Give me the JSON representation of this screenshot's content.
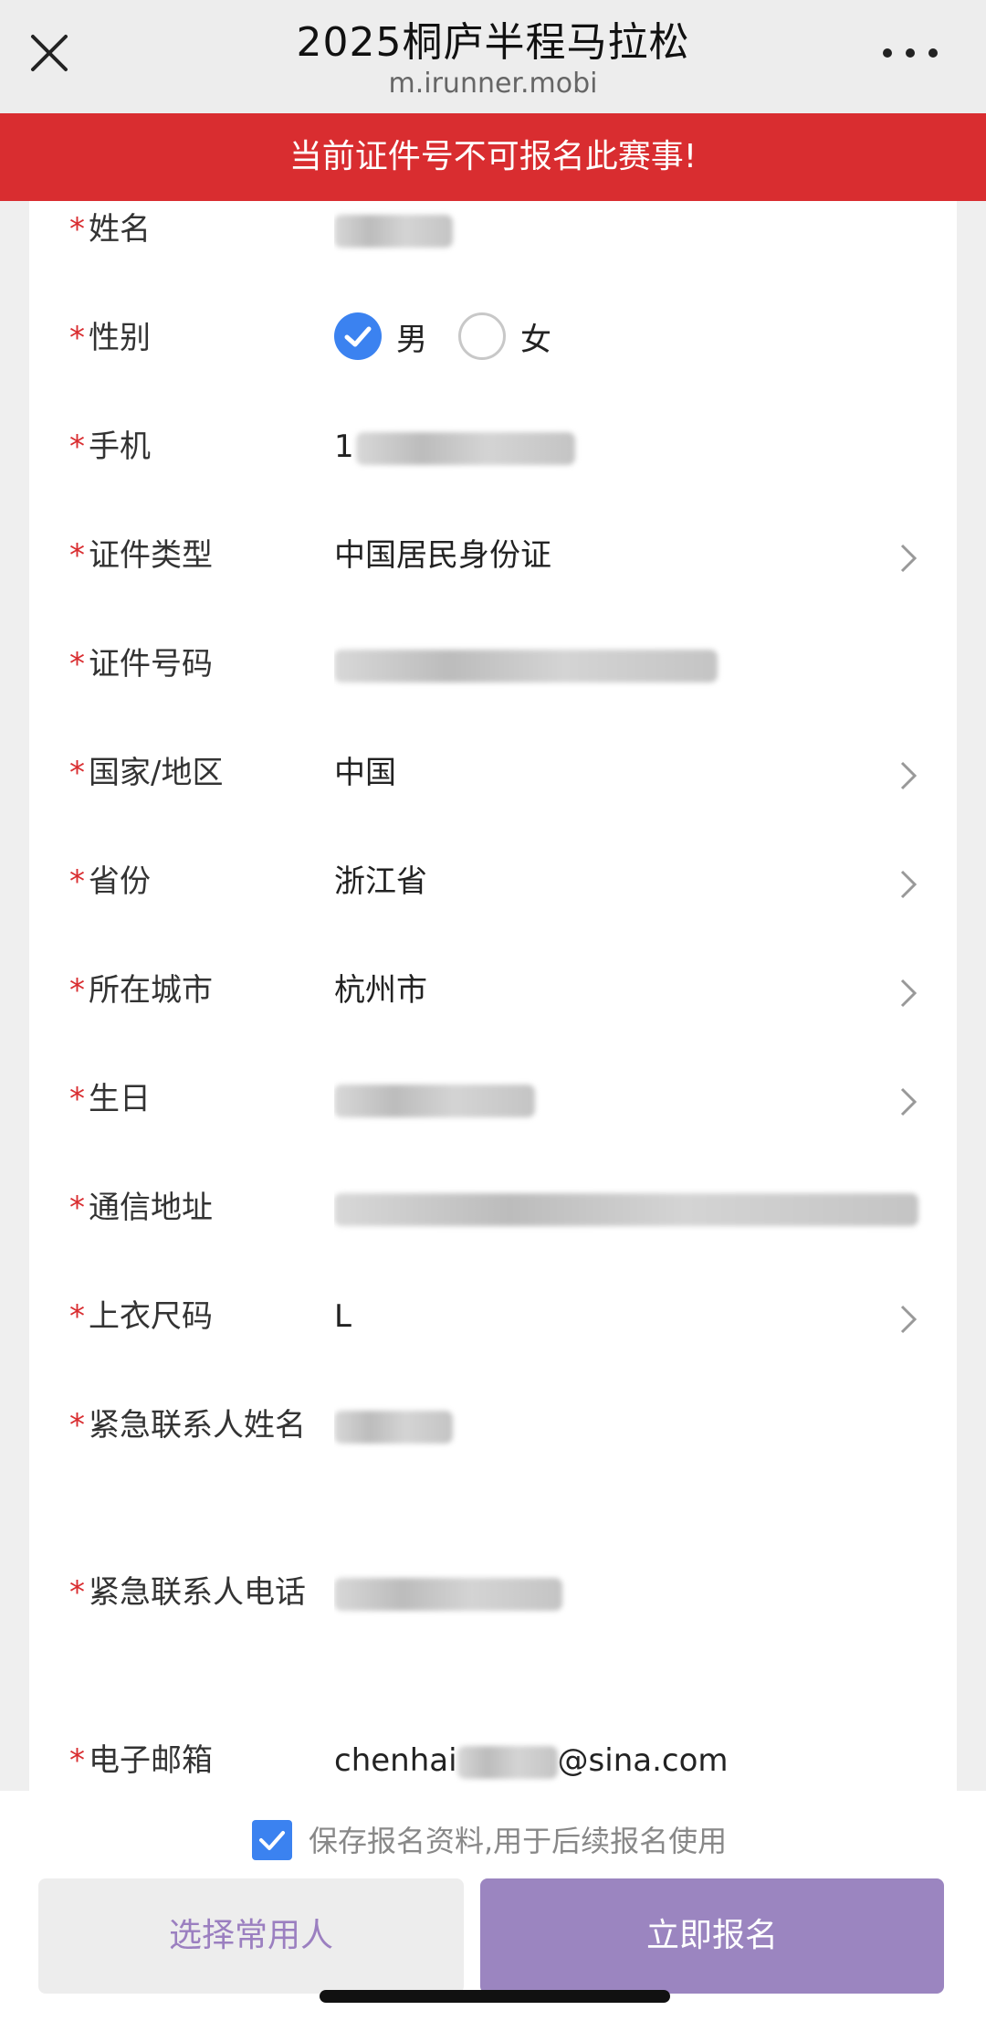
{
  "topbar": {
    "title": "2025桐庐半程马拉松",
    "subtitle": "m.irunner.mobi",
    "close_icon": "close-icon",
    "more_icon": "more-horizontal-icon"
  },
  "alert": {
    "text": "当前证件号不可报名此赛事!"
  },
  "form": {
    "required_mark": "*",
    "name": {
      "label": "姓名"
    },
    "gender": {
      "label": "性别",
      "options": [
        "男",
        "女"
      ],
      "selected": "男"
    },
    "phone": {
      "label": "手机",
      "value_visible": "1"
    },
    "id_type": {
      "label": "证件类型",
      "value": "中国居民身份证"
    },
    "id_number": {
      "label": "证件号码"
    },
    "country": {
      "label": "国家/地区",
      "value": "中国"
    },
    "province": {
      "label": "省份",
      "value": "浙江省"
    },
    "city": {
      "label": "所在城市",
      "value": "杭州市"
    },
    "birthday": {
      "label": "生日"
    },
    "address": {
      "label": "通信地址"
    },
    "shirt_size": {
      "label": "上衣尺码",
      "value": "L"
    },
    "emergency_name": {
      "label": "紧急联系人姓名"
    },
    "emergency_phone": {
      "label": "紧急联系人电话"
    },
    "email": {
      "label": "电子邮箱",
      "value_prefix": "chenhai",
      "value_suffix": "@sina.com"
    }
  },
  "bottom": {
    "save_label": "保存报名资料,用于后续报名使用",
    "save_checked": true,
    "select_button": "选择常用人",
    "submit_button": "立即报名"
  },
  "colors": {
    "alert": "#d92d30",
    "accent_blue": "#3b82f0",
    "submit_purple": "#9b85c0",
    "select_text": "#9b7fc0"
  }
}
